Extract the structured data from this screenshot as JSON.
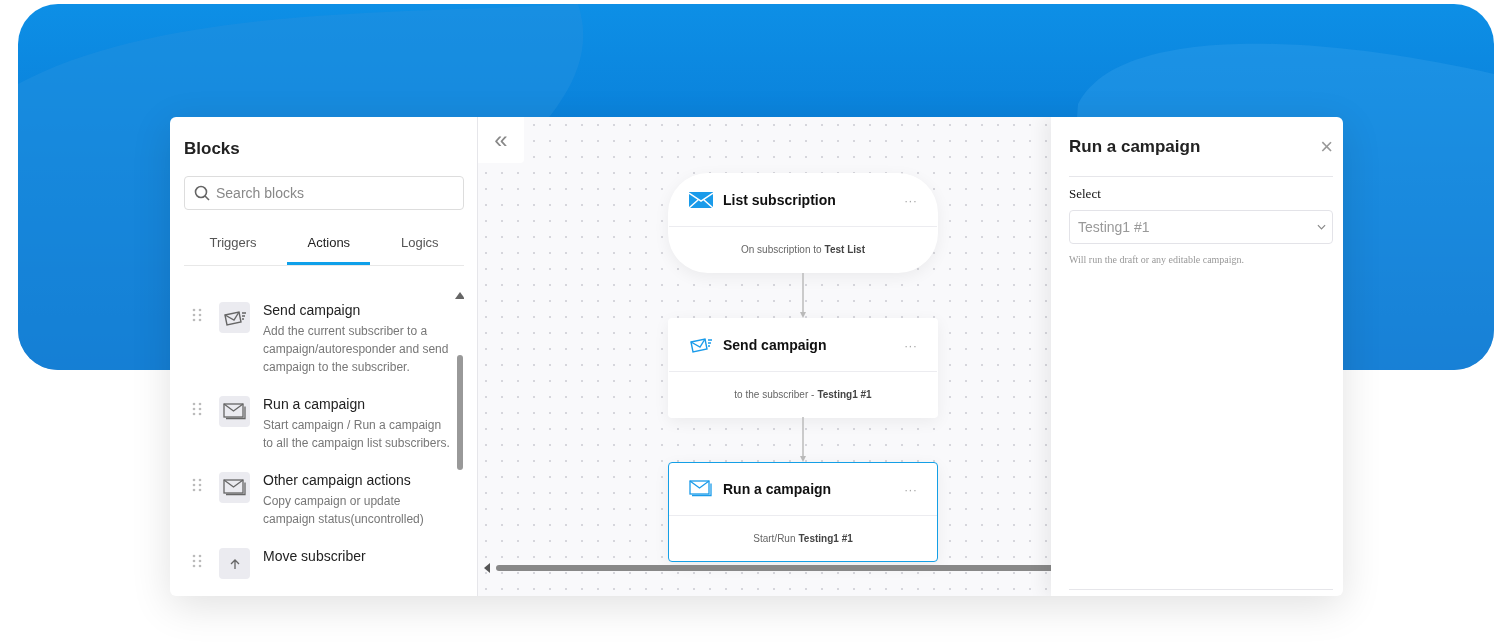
{
  "sidebar": {
    "title": "Blocks",
    "search": {
      "placeholder": "Search blocks"
    },
    "tabs": [
      {
        "label": "Triggers",
        "selected": false
      },
      {
        "label": "Actions",
        "selected": true
      },
      {
        "label": "Logics",
        "selected": false
      }
    ],
    "blocks": [
      {
        "kind": "send",
        "title": "Send campaign",
        "description": "Add the current subscriber to a campaign/autoresponder and send campaign to the subscriber."
      },
      {
        "kind": "run",
        "title": "Run a campaign",
        "description": "Start campaign / Run a campaign to all the campaign list subscribers."
      },
      {
        "kind": "run",
        "title": "Other campaign actions",
        "description": "Copy campaign or update campaign status(uncontrolled)"
      },
      {
        "kind": "move",
        "title": "Move subscriber"
      }
    ]
  },
  "canvas": {
    "collapse_label": "«",
    "nodes": [
      {
        "kind": "trigger",
        "title": "List subscription",
        "menu": "···",
        "detail": "On subscription to **Test List**",
        "selected": false
      },
      {
        "kind": "send",
        "title": "Send campaign",
        "menu": "···",
        "detail": "to the subscriber - **Testing1 #1**",
        "selected": false
      },
      {
        "kind": "run",
        "title": "Run a campaign",
        "menu": "···",
        "detail": "Start/Run **Testing1 #1**",
        "selected": true
      }
    ]
  },
  "panel": {
    "title": "Run a campaign",
    "close": "×",
    "field_label": "Select",
    "select": {
      "value": "Testing1 #1"
    },
    "help": "Will run the draft or any editable campaign."
  }
}
